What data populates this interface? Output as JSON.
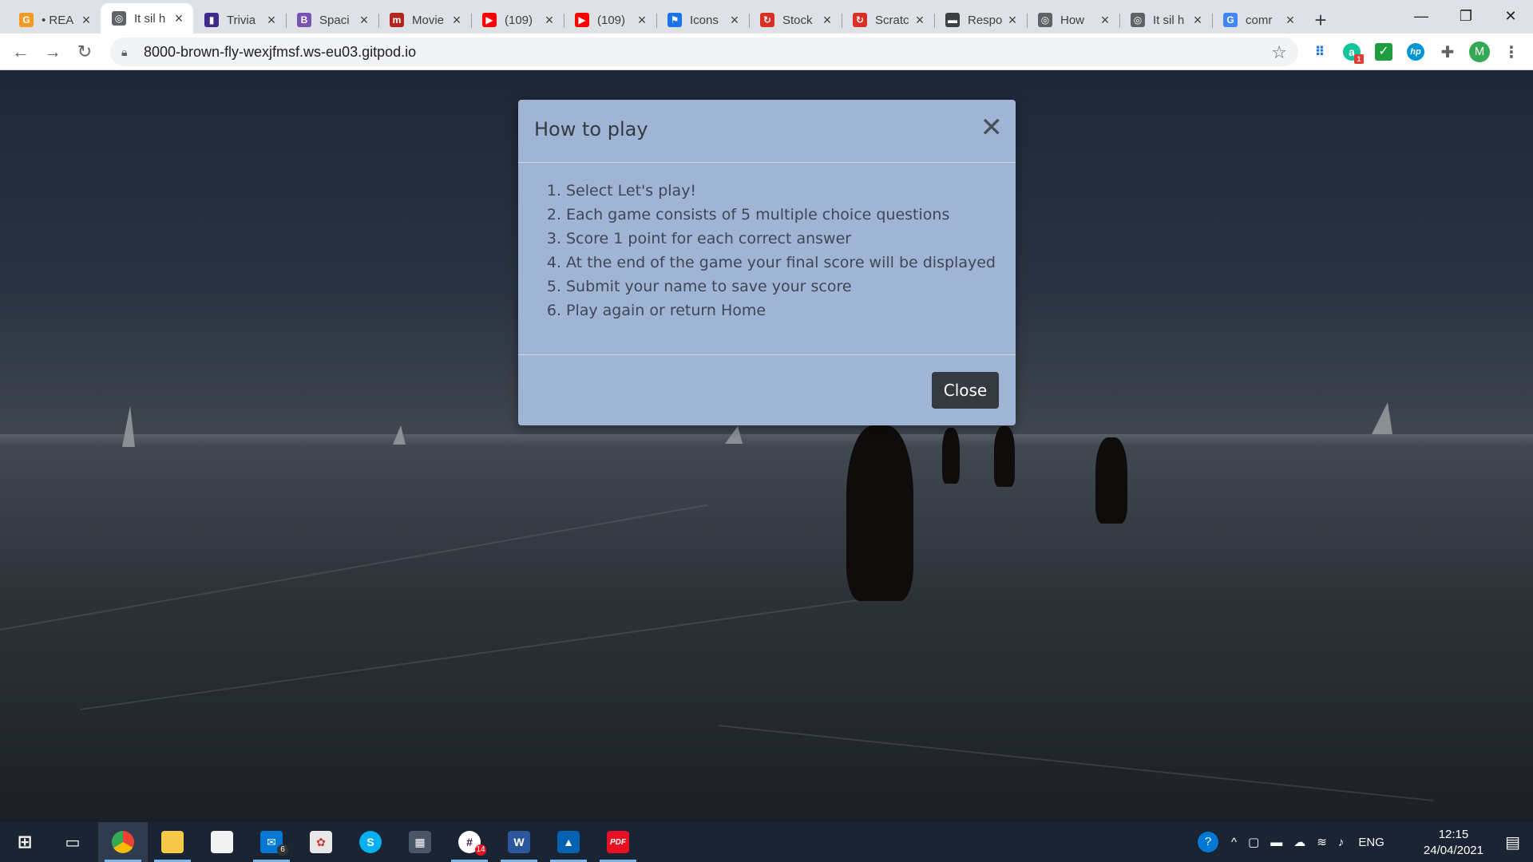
{
  "browser": {
    "tabs": [
      {
        "title": "• REA",
        "fav": "G",
        "fav_color": "#f29b24",
        "fav_name": "google-icon"
      },
      {
        "title": "It sil h",
        "fav": "◎",
        "fav_color": "#5f6368",
        "fav_name": "globe-icon",
        "active": true
      },
      {
        "title": "Trivia",
        "fav": "▮",
        "fav_color": "#3f2a8c",
        "fav_name": "trivia-icon"
      },
      {
        "title": "Spaci",
        "fav": "B",
        "fav_color": "#7952b3",
        "fav_name": "bootstrap-icon"
      },
      {
        "title": "Movie",
        "fav": "m",
        "fav_color": "#b3261e",
        "fav_name": "movie-icon"
      },
      {
        "title": "(109)",
        "fav": "▶",
        "fav_color": "#ff0000",
        "fav_name": "youtube-icon"
      },
      {
        "title": "(109)",
        "fav": "▶",
        "fav_color": "#ff0000",
        "fav_name": "youtube-icon"
      },
      {
        "title": "Icons",
        "fav": "⚑",
        "fav_color": "#1a73e8",
        "fav_name": "icons-site-icon"
      },
      {
        "title": "Stock",
        "fav": "↻",
        "fav_color": "#d93025",
        "fav_name": "stock-icon"
      },
      {
        "title": "Scratc",
        "fav": "↻",
        "fav_color": "#d93025",
        "fav_name": "scratch-icon"
      },
      {
        "title": "Respo",
        "fav": "▬",
        "fav_color": "#3c4043",
        "fav_name": "responsive-icon"
      },
      {
        "title": "How",
        "fav": "◎",
        "fav_color": "#5f6368",
        "fav_name": "globe-icon"
      },
      {
        "title": "It sil h",
        "fav": "◎",
        "fav_color": "#5f6368",
        "fav_name": "globe-icon"
      },
      {
        "title": "comr",
        "fav": "G",
        "fav_color": "#4285f4",
        "fav_name": "google-icon"
      }
    ],
    "new_tab": "+",
    "window_controls": {
      "minimize": "—",
      "maximize": "❐",
      "close": "✕"
    },
    "url": "8000-brown-fly-wexjfmsf.ws-eu03.gitpod.io",
    "profile_initial": "M",
    "extension_badge": "1"
  },
  "modal": {
    "title": "How to play",
    "close_x": "✕",
    "steps": [
      "Select Let's play!",
      "Each game consists of 5 multiple choice questions",
      "Score 1 point for each correct answer",
      "At the end of the game your final score will be displayed",
      "Submit your name to save your score",
      "Play again or return Home"
    ],
    "close_button": "Close"
  },
  "taskbar": {
    "mail_badge": "6",
    "slack_badge": "14",
    "word_label": "W",
    "pdf_label": "PDF",
    "language": "ENG",
    "time": "12:15",
    "date": "24/04/2021"
  }
}
